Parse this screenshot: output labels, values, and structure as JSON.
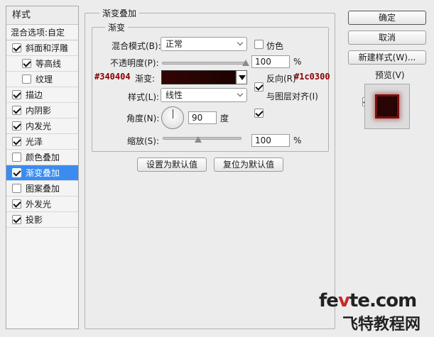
{
  "styles_panel": {
    "header": "样式",
    "blend_options": "混合选项:自定",
    "items": [
      {
        "label": "斜面和浮雕",
        "checked": true,
        "indent": false,
        "selected": false
      },
      {
        "label": "等高线",
        "checked": true,
        "indent": true,
        "selected": false
      },
      {
        "label": "纹理",
        "checked": false,
        "indent": true,
        "selected": false
      },
      {
        "label": "描边",
        "checked": true,
        "indent": false,
        "selected": false
      },
      {
        "label": "内阴影",
        "checked": true,
        "indent": false,
        "selected": false
      },
      {
        "label": "内发光",
        "checked": true,
        "indent": false,
        "selected": false
      },
      {
        "label": "光泽",
        "checked": true,
        "indent": false,
        "selected": false
      },
      {
        "label": "颜色叠加",
        "checked": false,
        "indent": false,
        "selected": false
      },
      {
        "label": "渐变叠加",
        "checked": true,
        "indent": false,
        "selected": true
      },
      {
        "label": "图案叠加",
        "checked": false,
        "indent": false,
        "selected": false
      },
      {
        "label": "外发光",
        "checked": true,
        "indent": false,
        "selected": false
      },
      {
        "label": "投影",
        "checked": true,
        "indent": false,
        "selected": false
      }
    ]
  },
  "gradient_overlay": {
    "group_title": "渐变叠加",
    "sub_group_title": "渐变",
    "blend_mode_label": "混合模式(B):",
    "blend_mode_value": "正常",
    "dither_label": "仿色",
    "dither_checked": false,
    "opacity_label": "不透明度(P):",
    "opacity_value": "100",
    "opacity_unit": "%",
    "opacity_fraction": 1.0,
    "gradient_label": "渐变:",
    "gradient_start_color": "#340404",
    "gradient_end_color": "#1c0300",
    "annot_start": "#340404",
    "annot_end": "#1c0300",
    "reverse_label": "反向(R)",
    "reverse_checked": true,
    "style_label": "样式(L):",
    "style_value": "线性",
    "align_label": "与图层对齐(I)",
    "align_checked": true,
    "angle_label": "角度(N):",
    "angle_value": "90",
    "angle_unit": "度",
    "scale_label": "缩放(S):",
    "scale_value": "100",
    "scale_unit": "%",
    "scale_fraction": 0.45,
    "set_default_label": "设置为默认值",
    "reset_default_label": "复位为默认值"
  },
  "actions": {
    "ok_label": "确定",
    "cancel_label": "取消",
    "new_style_label": "新建样式(W)...",
    "preview_label": "预览(V)",
    "preview_checked": true
  },
  "watermark": {
    "en_prefix": "fe",
    "en_accent": "v",
    "en_suffix": "te.com",
    "cn": "飞特教程网"
  }
}
